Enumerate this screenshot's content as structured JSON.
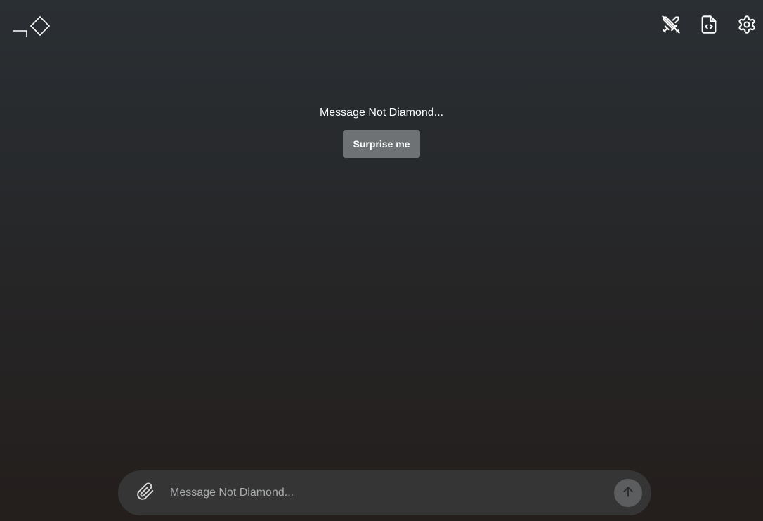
{
  "header": {
    "logo_icon": "not-diamond-logo-icon",
    "actions": [
      {
        "icon": "crossed-swords-icon"
      },
      {
        "icon": "file-code-icon"
      },
      {
        "icon": "gear-icon"
      }
    ]
  },
  "hero": {
    "title": "Message Not Diamond...",
    "surprise_label": "Surprise me"
  },
  "composer": {
    "attach_icon": "paperclip-icon",
    "placeholder": "Message Not Diamond...",
    "value": "",
    "send_icon": "arrow-up-icon"
  },
  "colors": {
    "background_top": "#2a2f33",
    "background_bottom": "#241e1c",
    "button_bg": "#6f7274",
    "composer_bg": "#353535",
    "send_bg": "#5c5d5e"
  }
}
